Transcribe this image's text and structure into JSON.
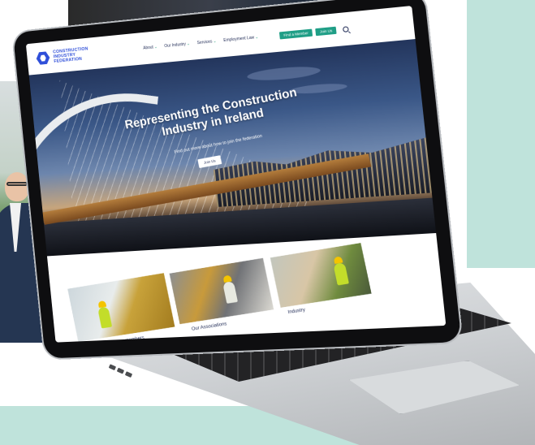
{
  "site": {
    "logo_text": "CONSTRUCTION INDUSTRY FEDERATION",
    "nav": {
      "menu": [
        {
          "label": "About"
        },
        {
          "label": "Our Industry"
        },
        {
          "label": "Services"
        },
        {
          "label": "Employment Law"
        }
      ],
      "buttons": {
        "primary": "Find a Member",
        "secondary": "Join Us"
      }
    },
    "hero": {
      "title": "Representing the Construction Industry in Ireland",
      "subtitle": "Find out more about how to join the federation",
      "button": "Join Us"
    },
    "cards": [
      {
        "label": "Services for our members"
      },
      {
        "label": "Our Associations"
      },
      {
        "label": "Industry"
      }
    ]
  },
  "colors": {
    "brand_blue": "#2f4fd9",
    "teal": "#1f9e86",
    "mint_background": "#bfe3db"
  },
  "icons": {
    "logo": "hexagon-logo-icon",
    "search": "search-icon",
    "dropdown": "chevron-down-icon"
  }
}
